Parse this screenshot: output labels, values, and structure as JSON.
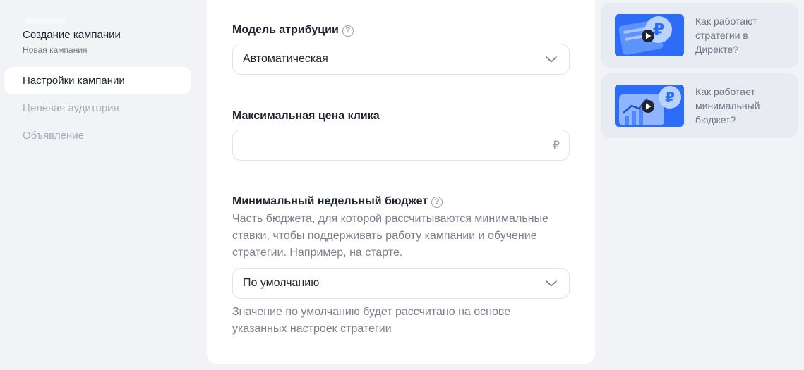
{
  "nav": {
    "title": "Создание кампании",
    "subtitle": "Новая кампания",
    "items": [
      {
        "label": "Настройки кампании",
        "active": true
      },
      {
        "label": "Целевая аудитория",
        "active": false
      },
      {
        "label": "Объявление",
        "active": false
      }
    ]
  },
  "form": {
    "attribution": {
      "label": "Модель атрибуции",
      "help_icon": "?",
      "value": "Автоматическая"
    },
    "max_click_price": {
      "label": "Максимальная цена клика",
      "value": "",
      "currency": "₽"
    },
    "weekly_budget": {
      "label": "Минимальный недельный бюджет",
      "help_icon": "?",
      "description": "Часть бюджета, для которой рассчитываются минимальные ставки, чтобы поддерживать работу кампании и обучение стратегии. Например, на старте.",
      "value": "По умолчанию",
      "hint": "Значение по умолчанию будет рассчитано на основе указанных настроек стратегии"
    }
  },
  "videos": [
    {
      "title": "Как работают стратегии в Директе?",
      "icon": "ruble-video-thumbnail"
    },
    {
      "title": "Как работает минимальный бюджет?",
      "icon": "budget-chart-video-thumbnail"
    }
  ],
  "colors": {
    "background": "#f2f3f6",
    "card": "#ffffff",
    "accent_blue": "#2d6cf6",
    "muted_text": "#7a808c",
    "video_card": "#e9ebf2"
  }
}
